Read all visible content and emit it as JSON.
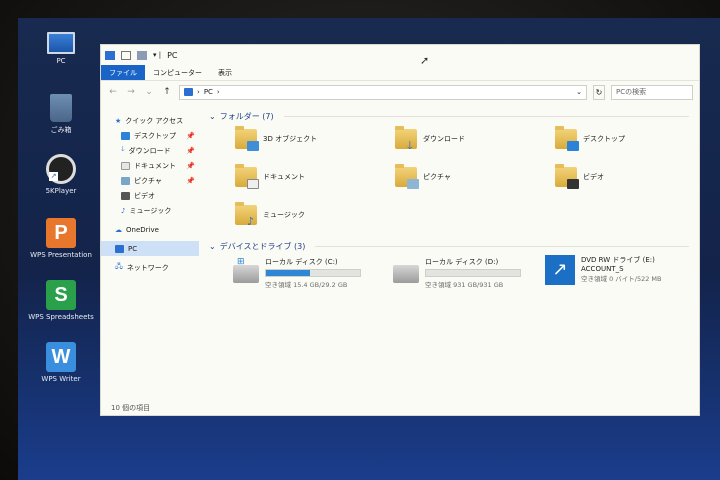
{
  "desktop": {
    "icons": [
      {
        "label": "PC",
        "icon": "pc-icon"
      },
      {
        "label": "ごみ箱",
        "icon": "recycle-bin-icon"
      },
      {
        "label": "5KPlayer",
        "icon": "5kplayer-icon"
      },
      {
        "label": "WPS Presentation",
        "icon": "wps-presentation-icon",
        "glyph": "P",
        "color": "#e8772e"
      },
      {
        "label": "WPS Spreadsheets",
        "icon": "wps-spreadsheets-icon",
        "glyph": "S",
        "color": "#2aa04a"
      },
      {
        "label": "WPS Writer",
        "icon": "wps-writer-icon",
        "glyph": "W",
        "color": "#3a8ede"
      }
    ]
  },
  "window": {
    "title": "PC",
    "tabs": [
      "ファイル",
      "コンピューター",
      "表示"
    ],
    "active_tab": "ファイル",
    "address": {
      "path": "PC",
      "separator": "›"
    },
    "search_placeholder": "PCの検索",
    "nav": {
      "quick_access": "クイック アクセス",
      "items": [
        {
          "label": "デスクトップ",
          "pinned": true
        },
        {
          "label": "ダウンロード",
          "pinned": true
        },
        {
          "label": "ドキュメント",
          "pinned": true
        },
        {
          "label": "ピクチャ",
          "pinned": true
        },
        {
          "label": "ビデオ",
          "pinned": false
        },
        {
          "label": "ミュージック",
          "pinned": false
        }
      ],
      "onedrive": "OneDrive",
      "pc": "PC",
      "network": "ネットワーク"
    },
    "folders_header": "フォルダー (7)",
    "folders": [
      {
        "label": "3D オブジェクト",
        "icon": "3d-objects-folder-icon"
      },
      {
        "label": "ダウンロード",
        "icon": "downloads-folder-icon"
      },
      {
        "label": "デスクトップ",
        "icon": "desktop-folder-icon"
      },
      {
        "label": "ドキュメント",
        "icon": "documents-folder-icon"
      },
      {
        "label": "ピクチャ",
        "icon": "pictures-folder-icon"
      },
      {
        "label": "ビデオ",
        "icon": "videos-folder-icon"
      },
      {
        "label": "ミュージック",
        "icon": "music-folder-icon"
      }
    ],
    "drives_header": "デバイスとドライブ (3)",
    "drives": [
      {
        "label": "ローカル ディスク (C:)",
        "free": "空き領域 15.4 GB/29.2 GB",
        "used_fraction": 0.47
      },
      {
        "label": "ローカル ディスク (D:)",
        "free": "空き領域 931 GB/931 GB",
        "used_fraction": 0.0
      },
      {
        "label": "DVD RW ドライブ (E:)",
        "volume": "ACCOUNT_S",
        "free": "空き領域 0 バイト/522 MB"
      }
    ],
    "status": "10 個の項目"
  },
  "colors": {
    "accent": "#1a63c7",
    "drive_bar": "#2e86d4",
    "group_header": "#1f3f8a"
  }
}
